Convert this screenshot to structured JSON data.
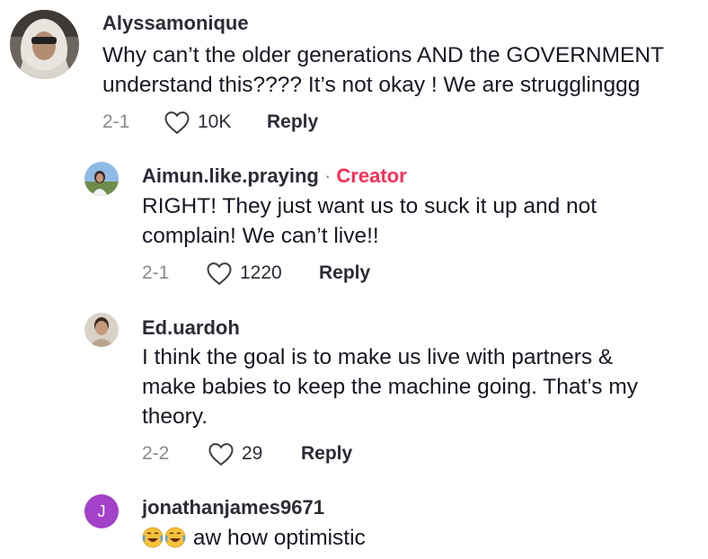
{
  "comments": [
    {
      "username": "Alyssamonique",
      "text_line1": "Why can’t the older generations AND the GOVERNMENT",
      "text_line2": "understand this???? It’s not okay ! We are strugglinggg",
      "date": "2-1",
      "likes": "10K",
      "reply_label": "Reply"
    },
    {
      "username": "Aimun.like.praying",
      "separator": "·",
      "badge": "Creator",
      "text_line1": "RIGHT! They just want us to suck it up and not",
      "text_line2": "complain! We can’t live!!",
      "date": "2-1",
      "likes": "1220",
      "reply_label": "Reply"
    },
    {
      "username": "Ed.uardoh",
      "text_line1": "I think the goal is to make us live with partners &",
      "text_line2": "make babies to keep the machine going. That’s my",
      "text_line3": "theory.",
      "date": "2-2",
      "likes": "29",
      "reply_label": "Reply"
    },
    {
      "username": "jonathanjames9671",
      "avatar_initial": "J",
      "text": "aw how optimistic",
      "emoji": [
        "face-with-tears-of-joy",
        "face-with-tears-of-joy"
      ],
      "avatar_color": "#a341c9"
    }
  ],
  "colors": {
    "creator": "#fe2c55",
    "meta": "#8a8b91",
    "text": "#161823"
  }
}
